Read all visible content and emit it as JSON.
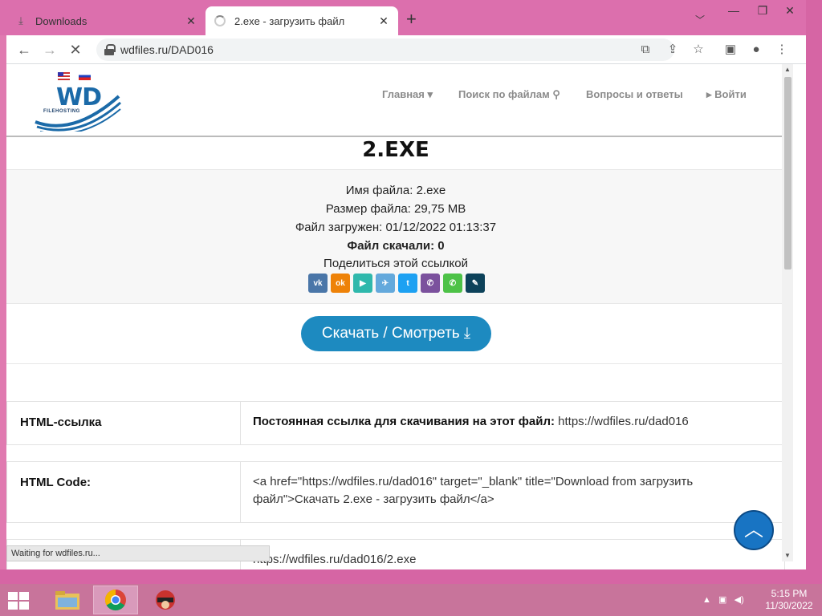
{
  "browser": {
    "tabs": [
      {
        "title": "Downloads",
        "icon": "download-icon",
        "active": false
      },
      {
        "title": "2.exe - загрузить файл",
        "icon": "loading-spinner-icon",
        "active": true
      }
    ],
    "address": "wdfiles.ru/DAD016",
    "status_text": "Waiting for wdfiles.ru..."
  },
  "site": {
    "logo_text": "WD",
    "logo_sub": "FILEHOSTING",
    "nav": [
      {
        "label": "Главная ▾"
      },
      {
        "label": "Поиск по файлам"
      },
      {
        "label": "Вопросы и ответы"
      },
      {
        "label": "▸ Войти"
      }
    ]
  },
  "file": {
    "title": "2.EXE",
    "name_line": "Имя файла: 2.exe",
    "size_line": "Размер файла: 29,75 MB",
    "uploaded_line": "Файл загружен: 01/12/2022 01:13:37",
    "downloads_line": "Файл скачали: 0",
    "share_label": "Поделиться этой ссылкой",
    "download_button": "Скачать / Смотреть"
  },
  "share_buttons": [
    {
      "name": "vk",
      "text": "vk",
      "color": "#4a76a8"
    },
    {
      "name": "odnoklassniki",
      "text": "ok",
      "color": "#ee8208"
    },
    {
      "name": "send",
      "text": "▶",
      "color": "#2fb8ac"
    },
    {
      "name": "telegram",
      "text": "✈",
      "color": "#64a9dc"
    },
    {
      "name": "twitter",
      "text": "t",
      "color": "#1da1f2"
    },
    {
      "name": "viber",
      "text": "✆",
      "color": "#7b519d"
    },
    {
      "name": "whatsapp",
      "text": "✆",
      "color": "#4dc247"
    },
    {
      "name": "livejournal",
      "text": "✎",
      "color": "#0d425a"
    }
  ],
  "links": {
    "html_link_label": "HTML-ссылка",
    "html_link_prefix": "Постоянная ссылка для скачивания на этот файл:",
    "html_link_url": "https://wdfiles.ru/dad016",
    "html_code_label": "HTML Code:",
    "html_code_line1": "<a href=\"https://wdfiles.ru/dad016\" target=\"_blank\" title=\"Download from загрузить",
    "html_code_line2": "файл\">Скачать 2.exe - загрузить файл</a>",
    "partial_url": "https://wdfiles.ru/dad016/2.exe"
  },
  "taskbar": {
    "time": "5:15 PM",
    "date": "11/30/2022"
  }
}
